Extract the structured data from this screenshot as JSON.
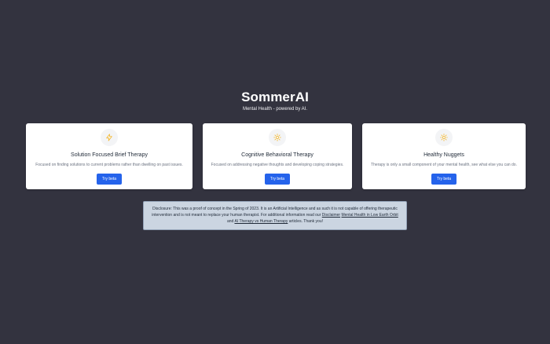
{
  "hero": {
    "title": "SommerAI",
    "subtitle": "Mental Health - powered by AI."
  },
  "cards": [
    {
      "icon": "lightning-icon",
      "title": "Solution Focused Brief Therapy",
      "description": "Focused on finding solutions to current problems rather than dwelling on past issues.",
      "button_label": "Try beta"
    },
    {
      "icon": "sun-icon",
      "title": "Cognitive Behavioral Therapy",
      "description": "Focused on addressing negative thoughts and developing coping strategies.",
      "button_label": "Try beta"
    },
    {
      "icon": "sun-icon",
      "title": "Healthy Nuggets",
      "description": "Therapy is only a small component of your mental health, see what else you can do.",
      "button_label": "Try beta"
    }
  ],
  "disclosure": {
    "text_before": "Disclosure: This was a proof of concept in the Spring of 2023. It is an Artificial Intelligence and as such it is not capable of offering therapeutic intervention and is not meant to replace your human therapist. For additional information read our ",
    "link_disclaimer": "Disclaimer",
    "link_leo": "Mental Health in Low Earth Orbit",
    "and_text": " and ",
    "link_ai_vs_human": "AI Therapy vs Human Therapy",
    "text_after": " articles. Thank you!"
  },
  "colors": {
    "background": "#33333f",
    "card": "#ffffff",
    "button": "#2563eb",
    "icon_accent": "#f5b82e",
    "disclosure_bg": "#cbd5e1"
  }
}
